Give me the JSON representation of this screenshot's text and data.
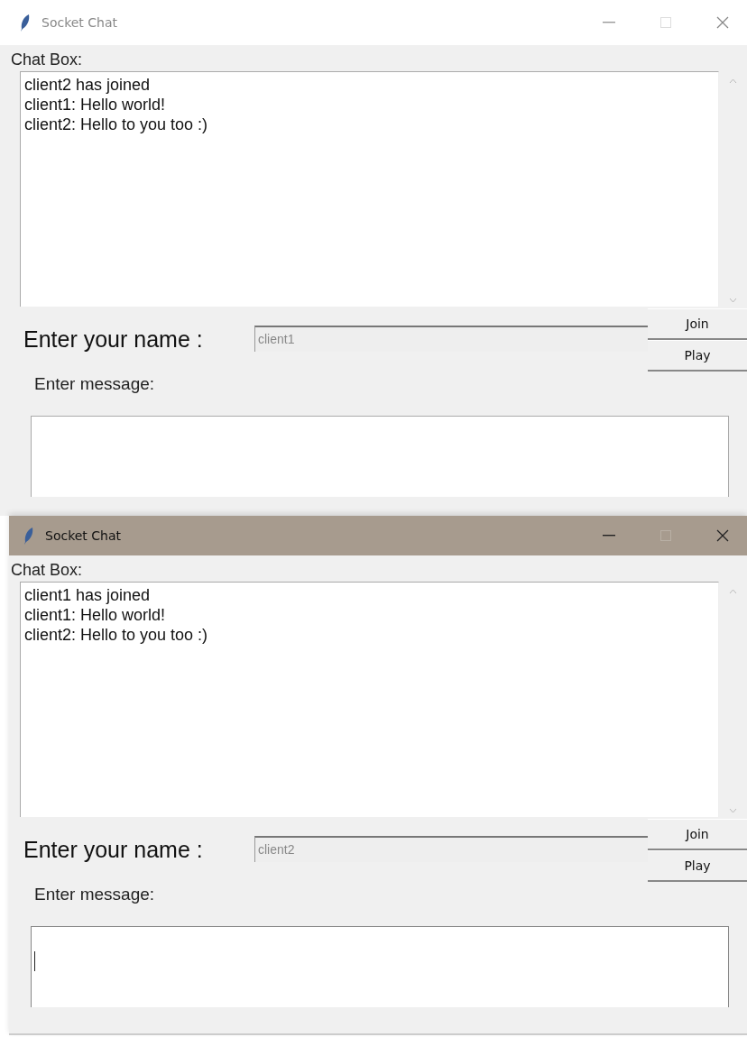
{
  "windows": [
    {
      "title": "Socket Chat",
      "active": false,
      "chat_label": "Chat Box:",
      "chat_lines": [
        "client2 has joined",
        "client1: Hello world!",
        "client2: Hello to you too :)"
      ],
      "name_label": "Enter your name :",
      "name_value": "client1",
      "buttons": [
        "Join",
        "Play"
      ],
      "message_label": "Enter message:",
      "message_focused": false
    },
    {
      "title": "Socket Chat",
      "active": true,
      "chat_label": "Chat Box:",
      "chat_lines": [
        "client1 has joined",
        "client1: Hello world!",
        "client2: Hello to you too :)"
      ],
      "name_label": "Enter your name :",
      "name_value": "client2",
      "buttons": [
        "Join",
        "Play"
      ],
      "message_label": "Enter message:",
      "message_focused": true
    }
  ]
}
